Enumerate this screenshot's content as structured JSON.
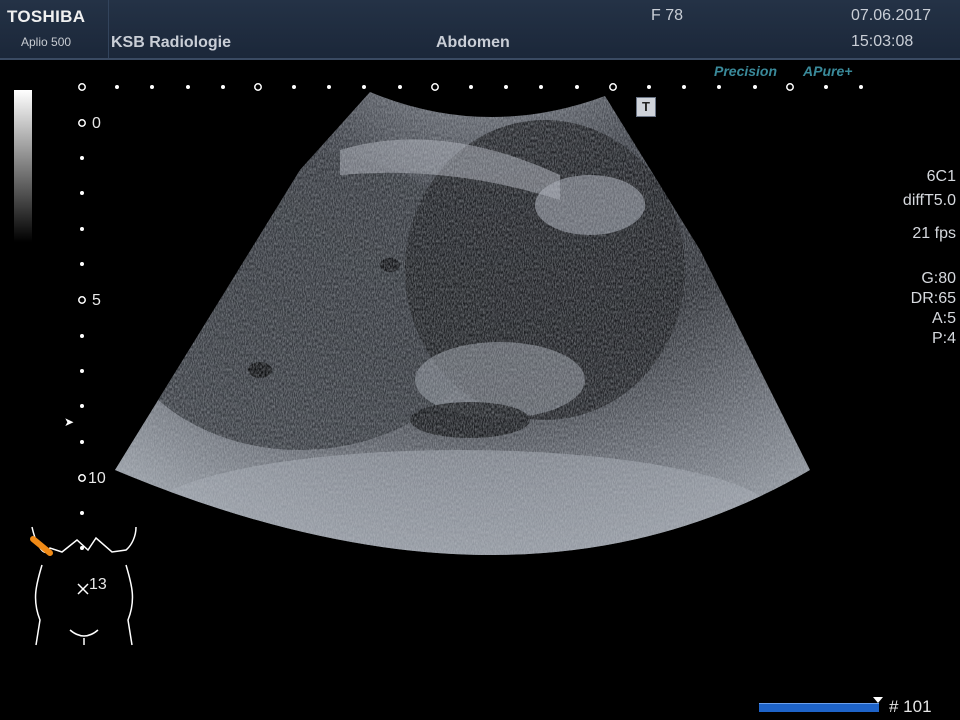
{
  "header": {
    "brand": "TOSHIBA",
    "model": "Aplio 500",
    "institution": "KSB Radiologie",
    "preset": "Abdomen",
    "frame_label": "F  78",
    "date": "07.06.2017",
    "time": "15:03:08"
  },
  "logos": {
    "precision": "Precision",
    "apure": "APure+"
  },
  "overlay": {
    "t_marker": "T",
    "focus_marker": "➤"
  },
  "depth_scale": {
    "labels": [
      "0",
      "5",
      "10"
    ]
  },
  "body_marker": {
    "label": "13"
  },
  "parameters": {
    "probe": "6C1",
    "filter": "diffT5.0",
    "frame_rate": "21 fps",
    "gain": "G:80",
    "dynamic_range": "DR:65",
    "a": "A:5",
    "p": "P:4"
  },
  "cine": {
    "frame_number": "# 101"
  },
  "colors": {
    "header_bg": "#1b2739",
    "logo_teal": "#3a8a9a",
    "probe_orientation": "#f08a16",
    "cine_bar": "#1e63c8"
  }
}
